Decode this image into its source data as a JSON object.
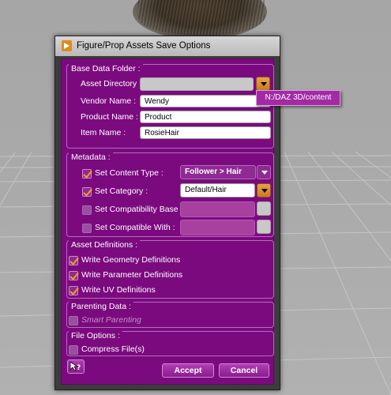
{
  "dialog": {
    "title": "Figure/Prop Assets Save Options"
  },
  "base_data_folder": {
    "group_title": "Base Data Folder :",
    "asset_directory": {
      "label": "Asset Directory :",
      "value": ""
    },
    "vendor_name": {
      "label": "Vendor Name :",
      "value": "Wendy"
    },
    "product_name": {
      "label": "Product Name :",
      "value": "Product"
    },
    "item_name": {
      "label": "Item Name :",
      "value": "RosieHair"
    },
    "directory_popup_option": "N:/DAZ 3D/content"
  },
  "metadata": {
    "group_title": "Metadata :",
    "content_type": {
      "label": "Set Content Type :",
      "checked": true,
      "value": "Follower > Hair"
    },
    "category": {
      "label": "Set Category :",
      "checked": true,
      "value": "Default/Hair"
    },
    "compatibility_base": {
      "label": "Set Compatibility Base :",
      "checked": false,
      "value": ""
    },
    "compatible_with": {
      "label": "Set Compatible With :",
      "checked": false,
      "value": ""
    }
  },
  "asset_definitions": {
    "group_title": "Asset Definitions :",
    "items": [
      {
        "label": "Write Geometry Definitions",
        "checked": true
      },
      {
        "label": "Write Parameter Definitions",
        "checked": true
      },
      {
        "label": "Write UV Definitions",
        "checked": true
      }
    ]
  },
  "parenting_data": {
    "group_title": "Parenting Data :",
    "smart_parenting": {
      "label": "Smart Parenting",
      "checked": false,
      "enabled": false
    }
  },
  "file_options": {
    "group_title": "File Options :",
    "compress": {
      "label": "Compress File(s)",
      "checked": false
    }
  },
  "buttons": {
    "accept": "Accept",
    "cancel": "Cancel"
  },
  "colors": {
    "dialog_body": "#7b0a7f",
    "checkmark": "#f2a11e",
    "accent_button": "#c97b20"
  },
  "icons": {
    "title": "daz-studio-app-icon",
    "help": "whats-this-help-icon"
  }
}
